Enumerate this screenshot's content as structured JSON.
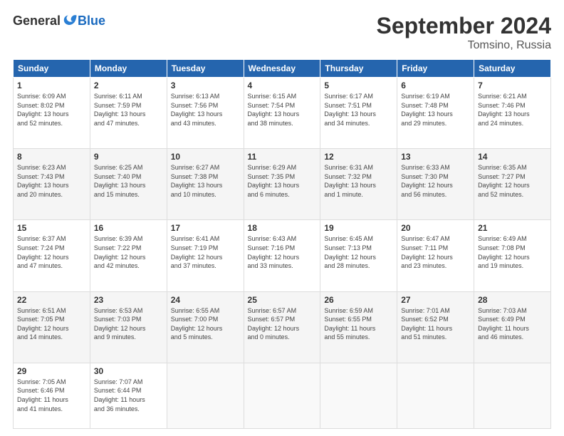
{
  "logo": {
    "general": "General",
    "blue": "Blue"
  },
  "title": {
    "month": "September 2024",
    "location": "Tomsino, Russia"
  },
  "headers": [
    "Sunday",
    "Monday",
    "Tuesday",
    "Wednesday",
    "Thursday",
    "Friday",
    "Saturday"
  ],
  "weeks": [
    [
      {
        "day": "1",
        "content": "Sunrise: 6:09 AM\nSunset: 8:02 PM\nDaylight: 13 hours\nand 52 minutes."
      },
      {
        "day": "2",
        "content": "Sunrise: 6:11 AM\nSunset: 7:59 PM\nDaylight: 13 hours\nand 47 minutes."
      },
      {
        "day": "3",
        "content": "Sunrise: 6:13 AM\nSunset: 7:56 PM\nDaylight: 13 hours\nand 43 minutes."
      },
      {
        "day": "4",
        "content": "Sunrise: 6:15 AM\nSunset: 7:54 PM\nDaylight: 13 hours\nand 38 minutes."
      },
      {
        "day": "5",
        "content": "Sunrise: 6:17 AM\nSunset: 7:51 PM\nDaylight: 13 hours\nand 34 minutes."
      },
      {
        "day": "6",
        "content": "Sunrise: 6:19 AM\nSunset: 7:48 PM\nDaylight: 13 hours\nand 29 minutes."
      },
      {
        "day": "7",
        "content": "Sunrise: 6:21 AM\nSunset: 7:46 PM\nDaylight: 13 hours\nand 24 minutes."
      }
    ],
    [
      {
        "day": "8",
        "content": "Sunrise: 6:23 AM\nSunset: 7:43 PM\nDaylight: 13 hours\nand 20 minutes."
      },
      {
        "day": "9",
        "content": "Sunrise: 6:25 AM\nSunset: 7:40 PM\nDaylight: 13 hours\nand 15 minutes."
      },
      {
        "day": "10",
        "content": "Sunrise: 6:27 AM\nSunset: 7:38 PM\nDaylight: 13 hours\nand 10 minutes."
      },
      {
        "day": "11",
        "content": "Sunrise: 6:29 AM\nSunset: 7:35 PM\nDaylight: 13 hours\nand 6 minutes."
      },
      {
        "day": "12",
        "content": "Sunrise: 6:31 AM\nSunset: 7:32 PM\nDaylight: 13 hours\nand 1 minute."
      },
      {
        "day": "13",
        "content": "Sunrise: 6:33 AM\nSunset: 7:30 PM\nDaylight: 12 hours\nand 56 minutes."
      },
      {
        "day": "14",
        "content": "Sunrise: 6:35 AM\nSunset: 7:27 PM\nDaylight: 12 hours\nand 52 minutes."
      }
    ],
    [
      {
        "day": "15",
        "content": "Sunrise: 6:37 AM\nSunset: 7:24 PM\nDaylight: 12 hours\nand 47 minutes."
      },
      {
        "day": "16",
        "content": "Sunrise: 6:39 AM\nSunset: 7:22 PM\nDaylight: 12 hours\nand 42 minutes."
      },
      {
        "day": "17",
        "content": "Sunrise: 6:41 AM\nSunset: 7:19 PM\nDaylight: 12 hours\nand 37 minutes."
      },
      {
        "day": "18",
        "content": "Sunrise: 6:43 AM\nSunset: 7:16 PM\nDaylight: 12 hours\nand 33 minutes."
      },
      {
        "day": "19",
        "content": "Sunrise: 6:45 AM\nSunset: 7:13 PM\nDaylight: 12 hours\nand 28 minutes."
      },
      {
        "day": "20",
        "content": "Sunrise: 6:47 AM\nSunset: 7:11 PM\nDaylight: 12 hours\nand 23 minutes."
      },
      {
        "day": "21",
        "content": "Sunrise: 6:49 AM\nSunset: 7:08 PM\nDaylight: 12 hours\nand 19 minutes."
      }
    ],
    [
      {
        "day": "22",
        "content": "Sunrise: 6:51 AM\nSunset: 7:05 PM\nDaylight: 12 hours\nand 14 minutes."
      },
      {
        "day": "23",
        "content": "Sunrise: 6:53 AM\nSunset: 7:03 PM\nDaylight: 12 hours\nand 9 minutes."
      },
      {
        "day": "24",
        "content": "Sunrise: 6:55 AM\nSunset: 7:00 PM\nDaylight: 12 hours\nand 5 minutes."
      },
      {
        "day": "25",
        "content": "Sunrise: 6:57 AM\nSunset: 6:57 PM\nDaylight: 12 hours\nand 0 minutes."
      },
      {
        "day": "26",
        "content": "Sunrise: 6:59 AM\nSunset: 6:55 PM\nDaylight: 11 hours\nand 55 minutes."
      },
      {
        "day": "27",
        "content": "Sunrise: 7:01 AM\nSunset: 6:52 PM\nDaylight: 11 hours\nand 51 minutes."
      },
      {
        "day": "28",
        "content": "Sunrise: 7:03 AM\nSunset: 6:49 PM\nDaylight: 11 hours\nand 46 minutes."
      }
    ],
    [
      {
        "day": "29",
        "content": "Sunrise: 7:05 AM\nSunset: 6:46 PM\nDaylight: 11 hours\nand 41 minutes."
      },
      {
        "day": "30",
        "content": "Sunrise: 7:07 AM\nSunset: 6:44 PM\nDaylight: 11 hours\nand 36 minutes."
      },
      {
        "day": "",
        "content": ""
      },
      {
        "day": "",
        "content": ""
      },
      {
        "day": "",
        "content": ""
      },
      {
        "day": "",
        "content": ""
      },
      {
        "day": "",
        "content": ""
      }
    ]
  ]
}
